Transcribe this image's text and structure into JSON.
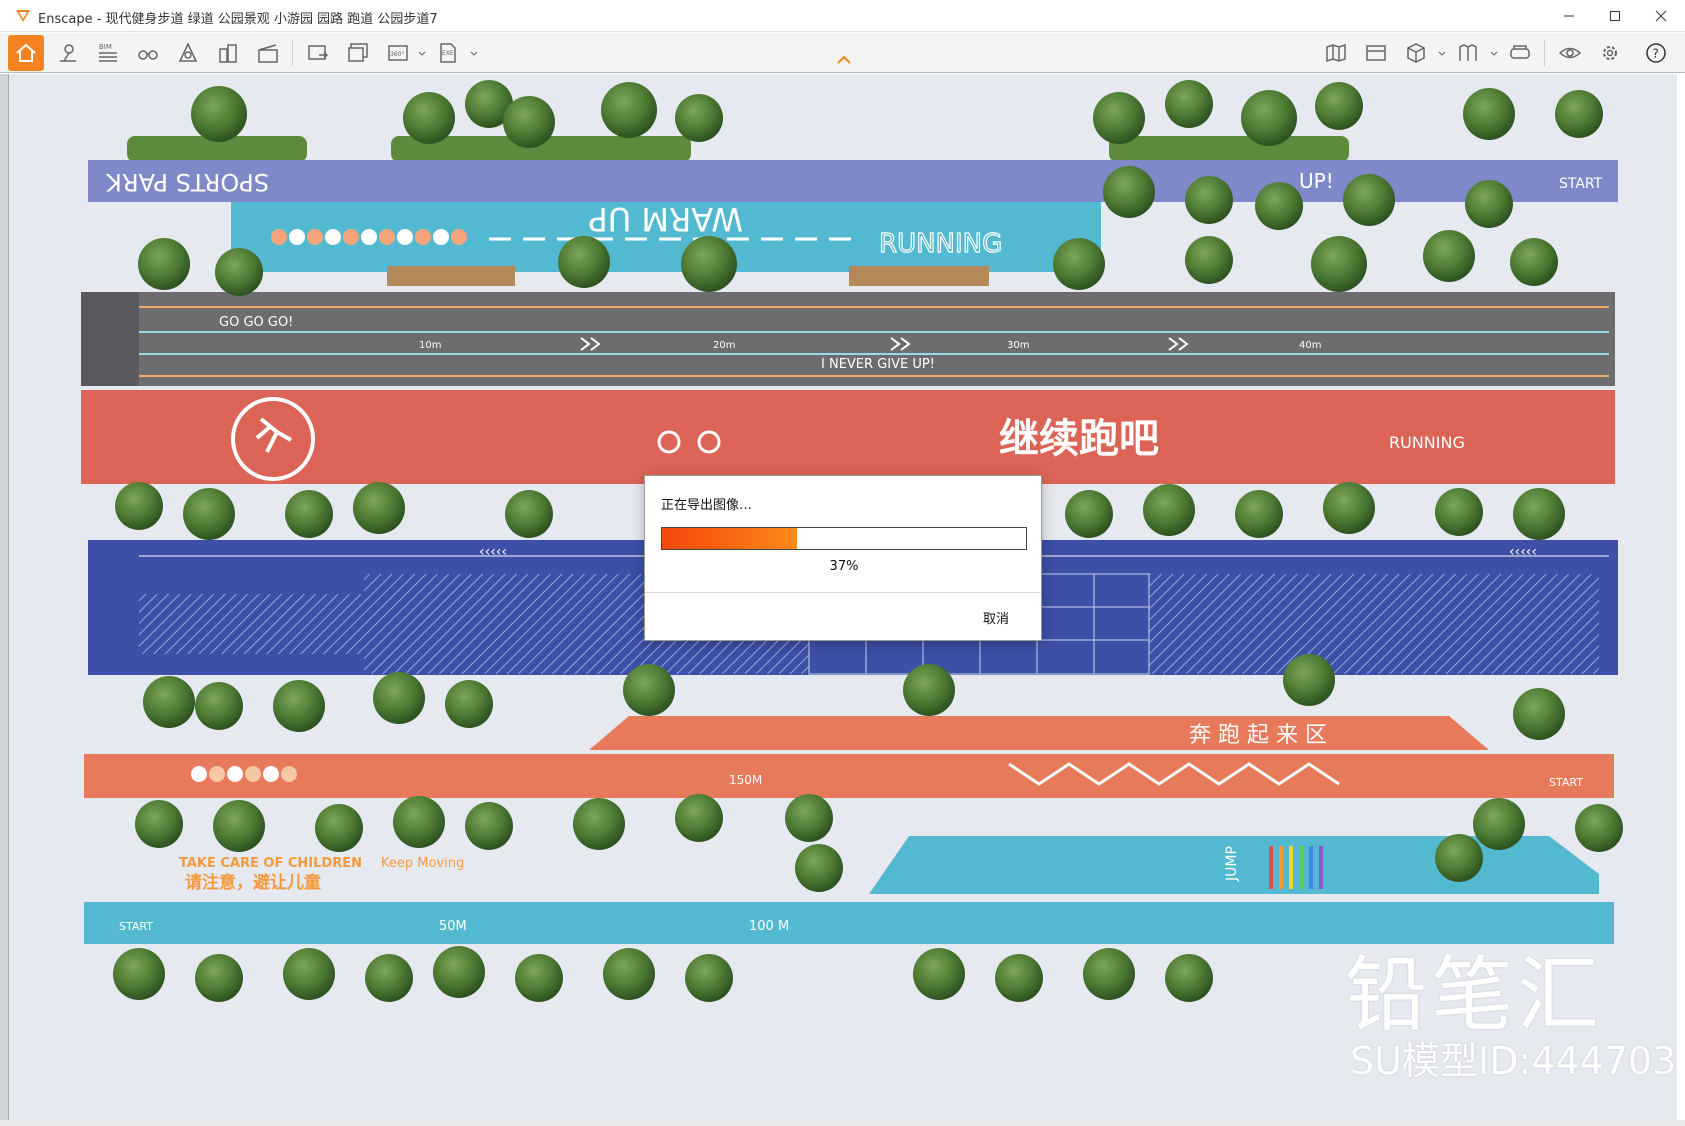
{
  "window": {
    "app_name": "Enscape",
    "title": "Enscape - 现代健身步道 绿道 公园景观 小游园 园路 跑道 公园步道7"
  },
  "toolbar": {
    "bim_label": "BIM",
    "pano_label": "360°",
    "exe_label": "EXE"
  },
  "scene": {
    "lane1_text": "SPORTS PARK",
    "lane1_right1": "UP!",
    "lane1_right2": "START",
    "lane2_text1": "WARM UP",
    "lane2_text2": "RUNNING",
    "track_text1": "GO GO GO!",
    "track_text2": "I NEVER GIVE UP!",
    "track_marks": [
      "10m",
      "20m",
      "30m",
      "40m"
    ],
    "red_title": "继续跑吧",
    "red_sub": "RUNNING",
    "lane_orange_text": "150M",
    "lane_orange_zone": "奔 跑 起 来 区",
    "lane_orange_start": "START",
    "kids_text1": "TAKE CARE OF CHILDREN",
    "kids_text2": "请注意，避让儿童",
    "kids_text3": "Keep Moving",
    "jump_text": "JUMP",
    "blue_marks": [
      "START",
      "50M",
      "100 M"
    ]
  },
  "dialog": {
    "title": "正在导出图像…",
    "progress": 37,
    "progress_label": "37%",
    "cancel_label": "取消"
  },
  "watermark": {
    "brand": "铅笔汇",
    "model_id": "SU模型ID:444703"
  },
  "colors": {
    "accent": "#f58220",
    "lane_lavender": "#7f88c9",
    "lane_cyan": "#53b9d0",
    "track_gray": "#6d6d70",
    "lane_red": "#dc6456",
    "lane_blue": "#3d4fa6",
    "lane_orange": "#e87a5c",
    "tree_green": "#4d7a33"
  }
}
